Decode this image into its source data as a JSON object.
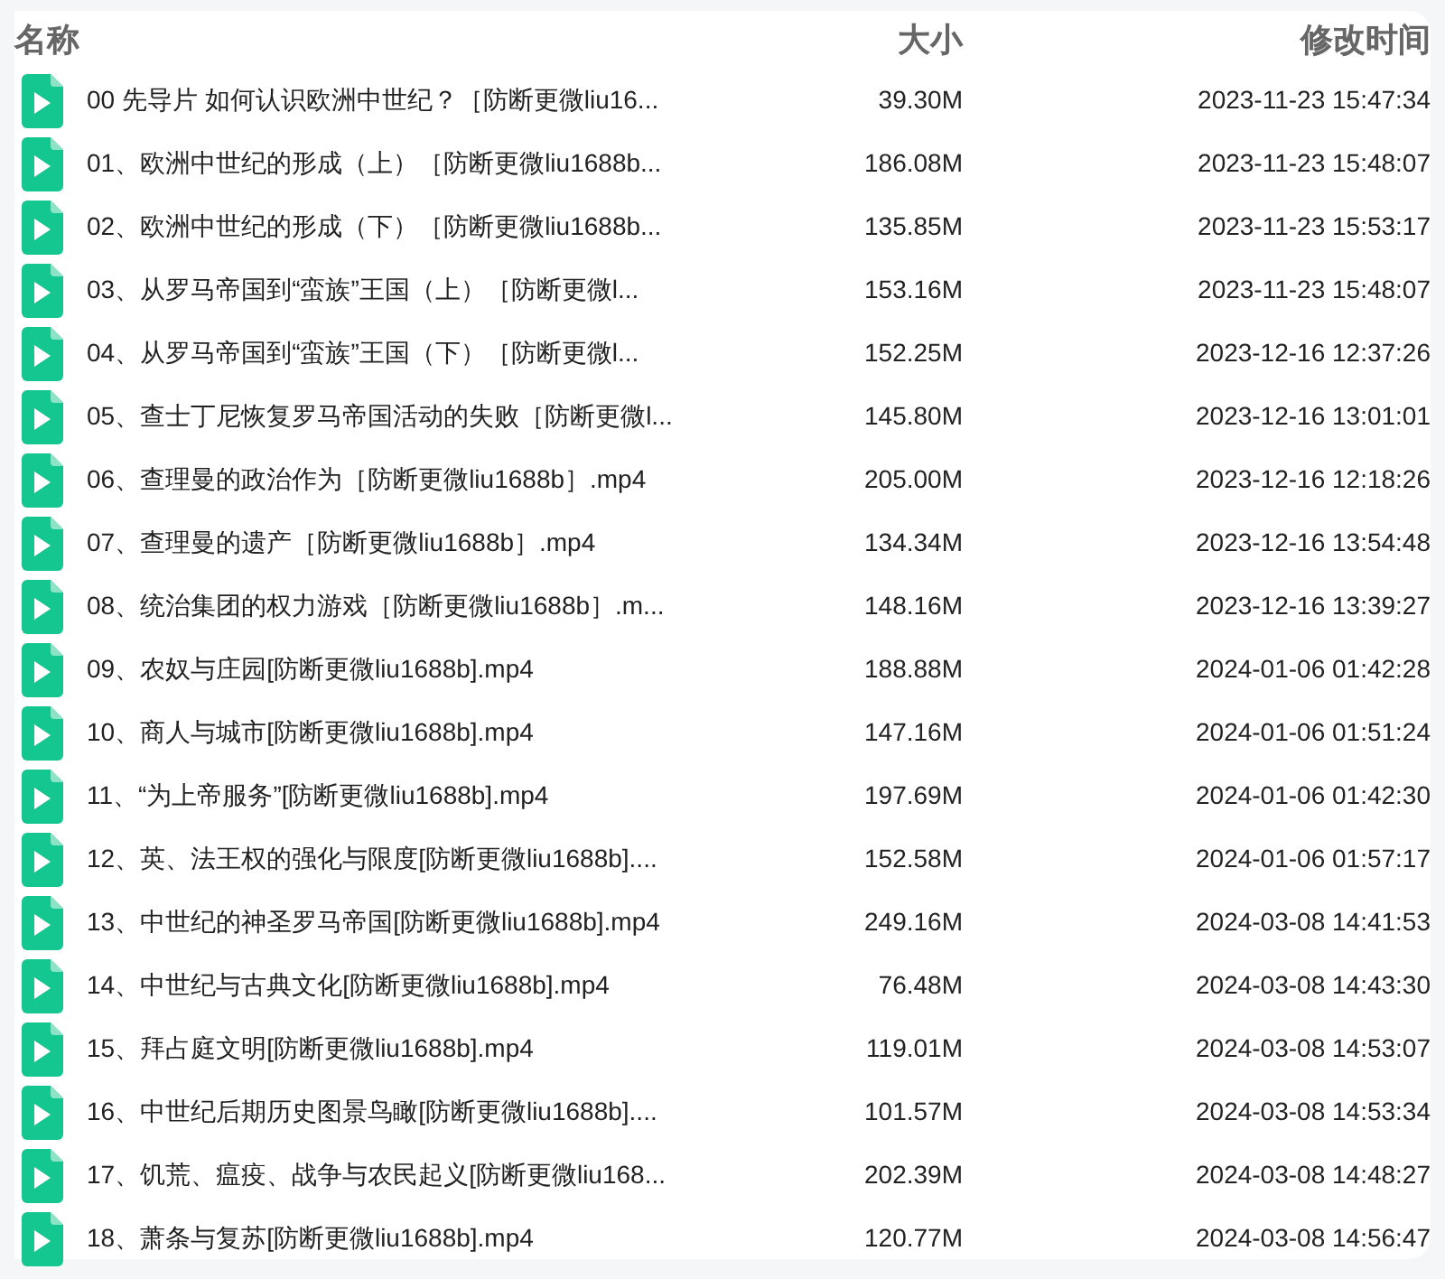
{
  "columns": [
    "名称",
    "大小",
    "修改时间"
  ],
  "files": [
    {
      "name": "00 先导片 如何认识欧洲中世纪？［防断更微liu16...",
      "size": "39.30M",
      "modified": "2023-11-23 15:47:34"
    },
    {
      "name": "01、欧洲中世纪的形成（上）［防断更微liu1688b...",
      "size": "186.08M",
      "modified": "2023-11-23 15:48:07"
    },
    {
      "name": "02、欧洲中世纪的形成（下）［防断更微liu1688b...",
      "size": "135.85M",
      "modified": "2023-11-23 15:53:17"
    },
    {
      "name": "03、从罗马帝国到“蛮族”王国（上）［防断更微l...",
      "size": "153.16M",
      "modified": "2023-11-23 15:48:07"
    },
    {
      "name": "04、从罗马帝国到“蛮族”王国（下）［防断更微l...",
      "size": "152.25M",
      "modified": "2023-12-16 12:37:26"
    },
    {
      "name": "05、查士丁尼恢复罗马帝国活动的失败［防断更微l...",
      "size": "145.80M",
      "modified": "2023-12-16 13:01:01"
    },
    {
      "name": "06、查理曼的政治作为［防断更微liu1688b］.mp4",
      "size": "205.00M",
      "modified": "2023-12-16 12:18:26"
    },
    {
      "name": "07、查理曼的遗产［防断更微liu1688b］.mp4",
      "size": "134.34M",
      "modified": "2023-12-16 13:54:48"
    },
    {
      "name": "08、统治集团的权力游戏［防断更微liu1688b］.m...",
      "size": "148.16M",
      "modified": "2023-12-16 13:39:27"
    },
    {
      "name": "09、农奴与庄园[防断更微liu1688b].mp4",
      "size": "188.88M",
      "modified": "2024-01-06 01:42:28"
    },
    {
      "name": "10、商人与城市[防断更微liu1688b].mp4",
      "size": "147.16M",
      "modified": "2024-01-06 01:51:24"
    },
    {
      "name": "11、“为上帝服务”[防断更微liu1688b].mp4",
      "size": "197.69M",
      "modified": "2024-01-06 01:42:30"
    },
    {
      "name": "12、英、法王权的强化与限度[防断更微liu1688b]....",
      "size": "152.58M",
      "modified": "2024-01-06 01:57:17"
    },
    {
      "name": "13、中世纪的神圣罗马帝国[防断更微liu1688b].mp4",
      "size": "249.16M",
      "modified": "2024-03-08 14:41:53"
    },
    {
      "name": "14、中世纪与古典文化[防断更微liu1688b].mp4",
      "size": "76.48M",
      "modified": "2024-03-08 14:43:30"
    },
    {
      "name": "15、拜占庭文明[防断更微liu1688b].mp4",
      "size": "119.01M",
      "modified": "2024-03-08 14:53:07"
    },
    {
      "name": "16、中世纪后期历史图景鸟瞰[防断更微liu1688b]....",
      "size": "101.57M",
      "modified": "2024-03-08 14:53:34"
    },
    {
      "name": "17、饥荒、瘟疫、战争与农民起义[防断更微liu168...",
      "size": "202.39M",
      "modified": "2024-03-08 14:48:27"
    },
    {
      "name": "18、萧条与复苏[防断更微liu1688b].mp4",
      "size": "120.77M",
      "modified": "2024-03-08 14:56:47"
    }
  ]
}
